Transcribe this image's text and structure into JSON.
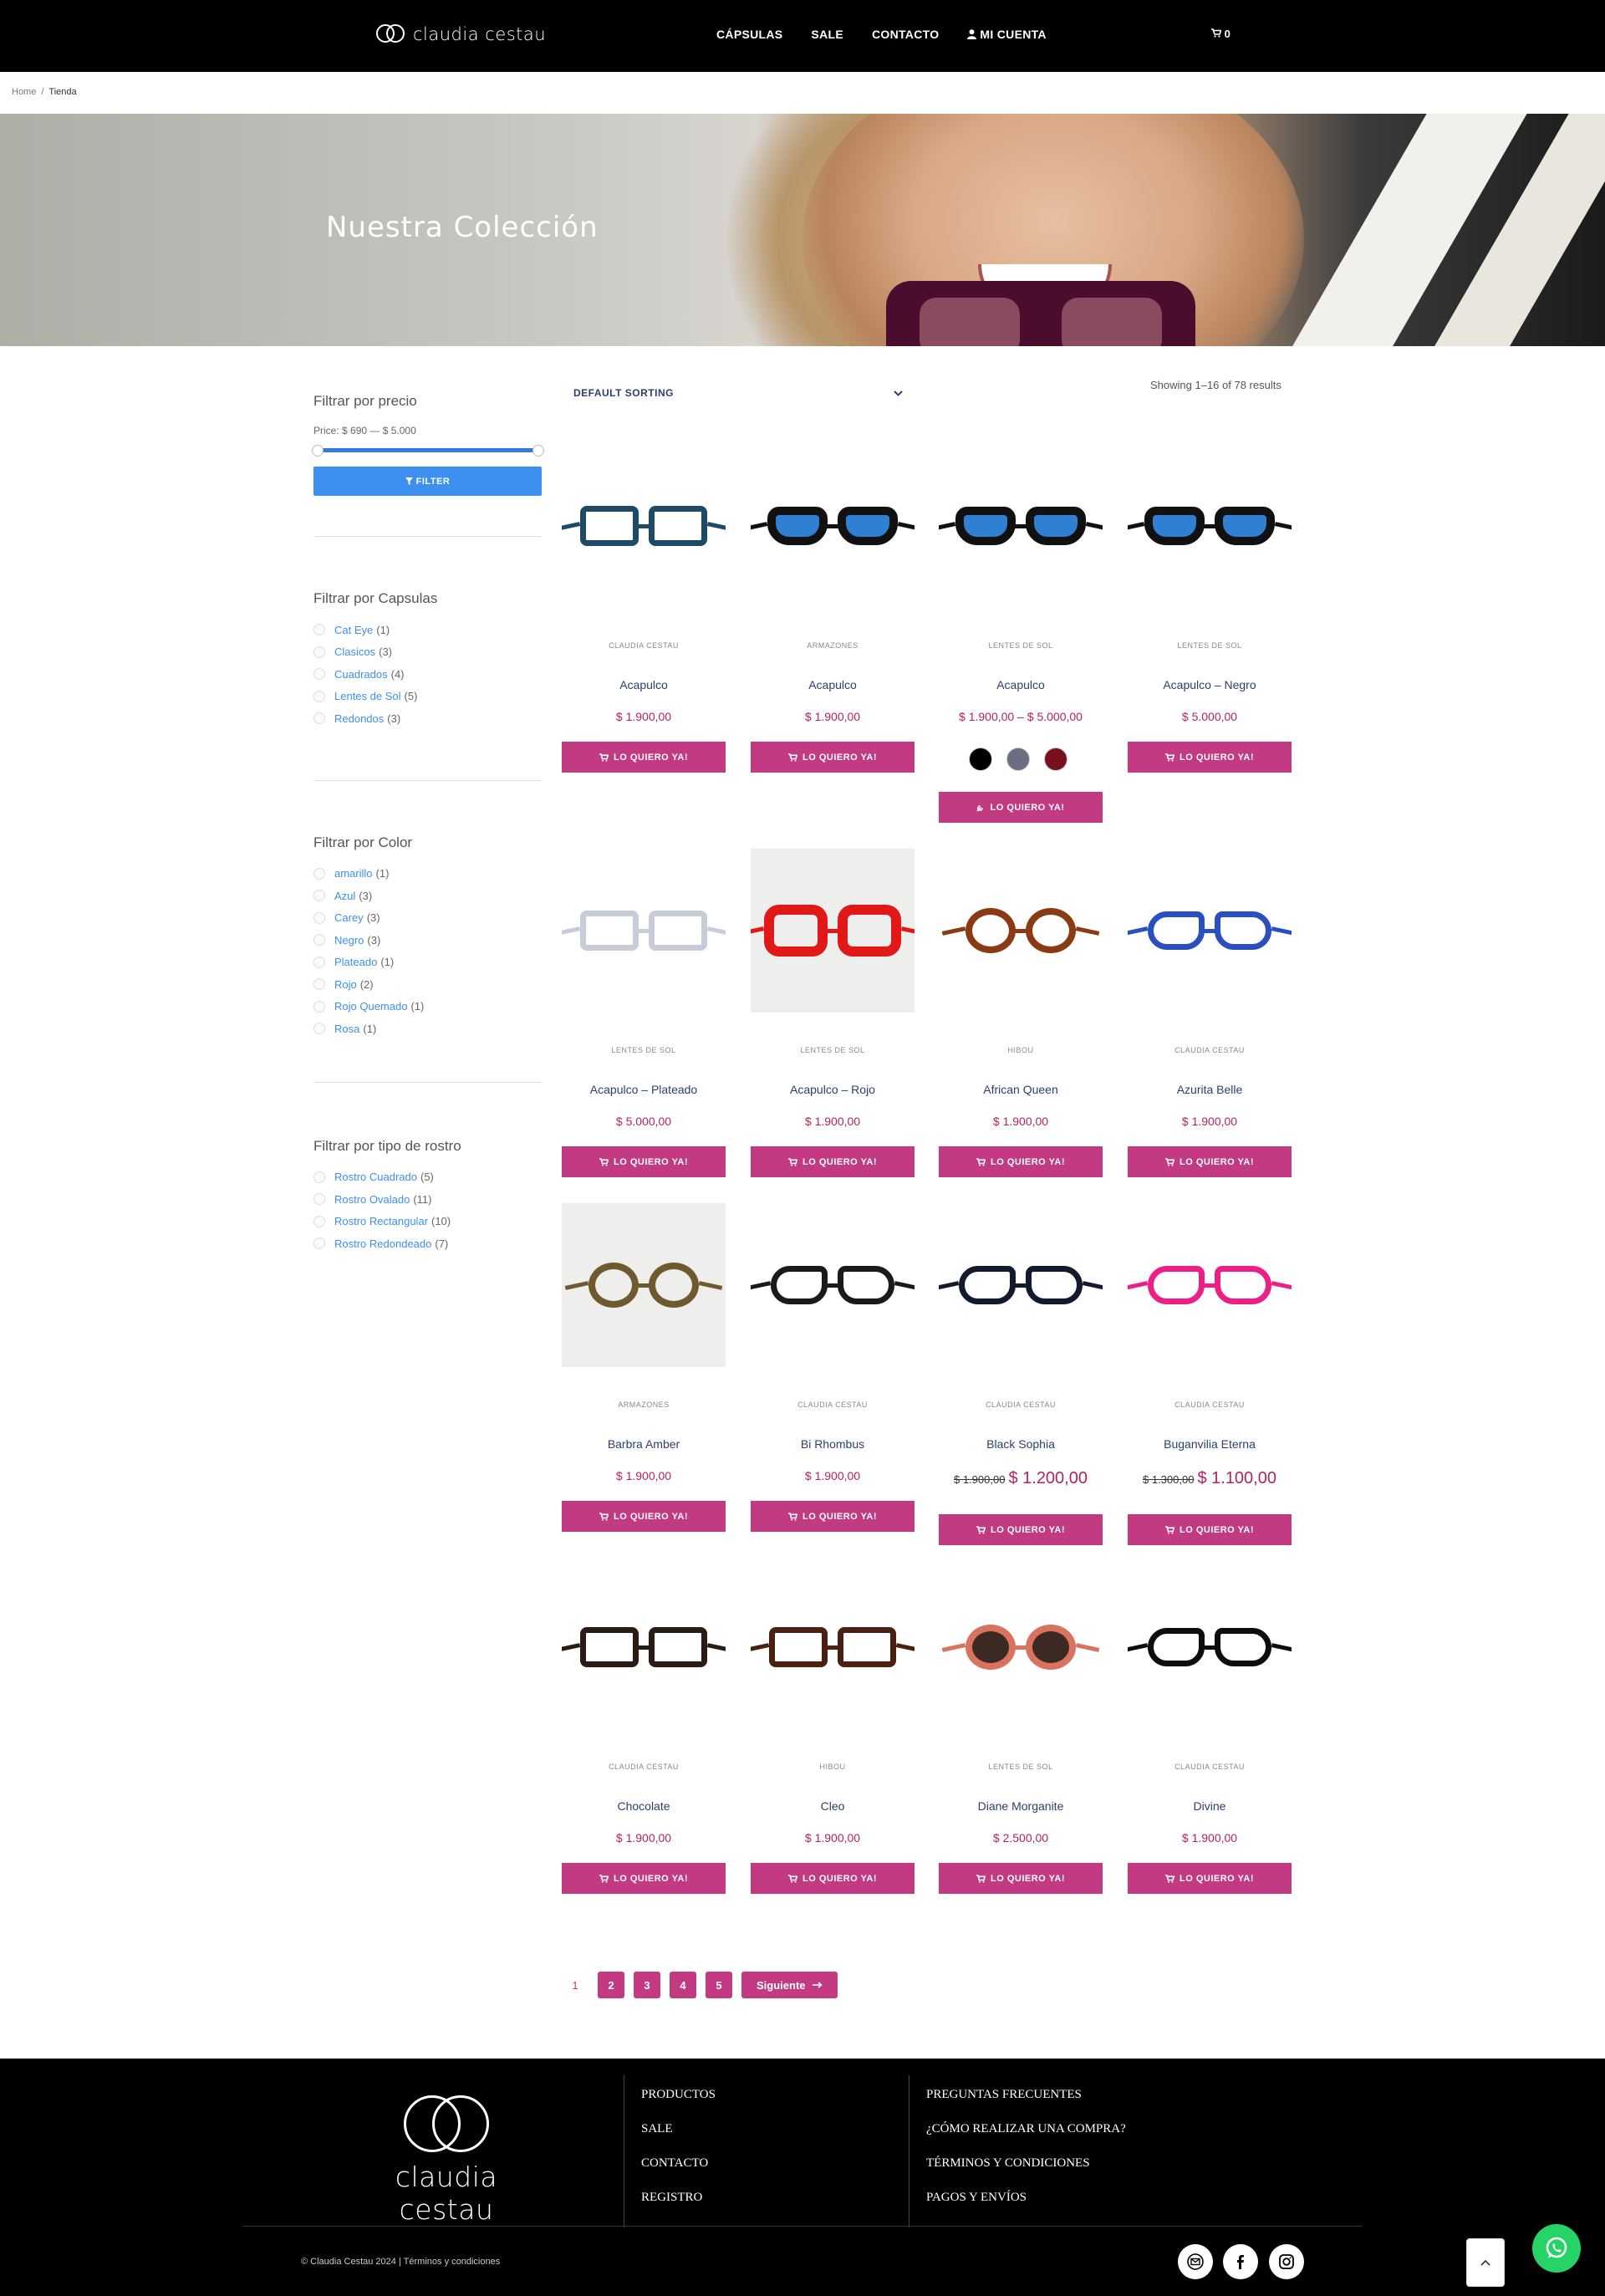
{
  "header": {
    "logo_text": "claudia cestau",
    "nav": [
      "CÁPSULAS",
      "SALE",
      "CONTACTO",
      "MI CUENTA"
    ],
    "cart_count": "0"
  },
  "breadcrumb": {
    "home": "Home",
    "sep": "/",
    "current": "Tienda"
  },
  "hero": {
    "title": "Nuestra Colección"
  },
  "sidebar": {
    "price": {
      "title": "Filtrar por precio",
      "label": "Price: $ 690 — $ 5.000",
      "button": "FILTER"
    },
    "capsulas": {
      "title": "Filtrar por Capsulas",
      "items": [
        {
          "label": "Cat Eye",
          "count": "(1)"
        },
        {
          "label": "Clasicos",
          "count": "(3)"
        },
        {
          "label": "Cuadrados",
          "count": "(4)"
        },
        {
          "label": "Lentes de Sol",
          "count": "(5)"
        },
        {
          "label": "Redondos",
          "count": "(3)"
        }
      ]
    },
    "color": {
      "title": "Filtrar por Color",
      "items": [
        {
          "label": "amarillo",
          "count": "(1)"
        },
        {
          "label": "Azul",
          "count": "(3)"
        },
        {
          "label": "Carey",
          "count": "(3)"
        },
        {
          "label": "Negro",
          "count": "(3)"
        },
        {
          "label": "Plateado",
          "count": "(1)"
        },
        {
          "label": "Rojo",
          "count": "(2)"
        },
        {
          "label": "Rojo Quemado",
          "count": "(1)"
        },
        {
          "label": "Rosa",
          "count": "(1)"
        }
      ]
    },
    "rostro": {
      "title": "Filtrar por tipo de rostro",
      "items": [
        {
          "label": "Rostro Cuadrado",
          "count": "(5)"
        },
        {
          "label": "Rostro Ovalado",
          "count": "(11)"
        },
        {
          "label": "Rostro Rectangular",
          "count": "(10)"
        },
        {
          "label": "Rostro Redondeado",
          "count": "(7)"
        }
      ]
    }
  },
  "shop": {
    "sorting": "DEFAULT SORTING",
    "result_count": "Showing 1–16 of 78 results",
    "buy_label": "LO QUIERO YA!"
  },
  "products": [
    {
      "category": "CLAUDIA CESTAU",
      "name": "Acapulco",
      "price": "$ 1.900,00",
      "frame": "#1f4a66",
      "lens": "transparent",
      "shape": "square",
      "bg": "white"
    },
    {
      "category": "ARMAZONES",
      "name": "Acapulco",
      "price": "$ 1.900,00",
      "frame": "#111111",
      "lens": "#2f7fd3",
      "shape": "wayfarer",
      "bg": "white"
    },
    {
      "category": "LENTES DE SOL",
      "name": "Acapulco",
      "price": "$ 1.900,00 – $ 5.000,00",
      "frame": "#111111",
      "lens": "#2f7fd3",
      "shape": "wayfarer",
      "bg": "white",
      "swatches": [
        "#000000",
        "#6b6e80",
        "#7a0f1f"
      ]
    },
    {
      "category": "LENTES DE SOL",
      "name": "Acapulco – Negro",
      "price": "$ 5.000,00",
      "frame": "#111111",
      "lens": "#2f7fd3",
      "shape": "wayfarer",
      "bg": "white"
    },
    {
      "category": "LENTES DE SOL",
      "name": "Acapulco – Plateado",
      "price": "$ 5.000,00",
      "frame": "#c7ccd8",
      "lens": "transparent",
      "shape": "square",
      "bg": "white"
    },
    {
      "category": "LENTES DE SOL",
      "name": "Acapulco – Rojo",
      "price": "$ 1.900,00",
      "frame": "#e01818",
      "lens": "transparent",
      "shape": "hexagon",
      "bg": "gray"
    },
    {
      "category": "HIBOU",
      "name": "African Queen",
      "price": "$ 1.900,00",
      "frame": "#8a3b14",
      "lens": "transparent",
      "shape": "round",
      "bg": "white"
    },
    {
      "category": "CLAUDIA CESTAU",
      "name": "Azurita Belle",
      "price": "$ 1.900,00",
      "frame": "#2a4fc0",
      "lens": "transparent",
      "shape": "cateye",
      "bg": "white"
    },
    {
      "category": "ARMAZONES",
      "name": "Barbra Amber",
      "price": "$ 1.900,00",
      "frame": "#6e5a2e",
      "lens": "transparent",
      "shape": "round",
      "bg": "gray"
    },
    {
      "category": "CLAUDIA CESTAU",
      "name": "Bi Rhombus",
      "price": "$ 1.900,00",
      "frame": "#1a1a1a",
      "lens": "transparent",
      "shape": "cateye",
      "bg": "white"
    },
    {
      "category": "CLAUDIA CESTAU",
      "name": "Black Sophia",
      "old_price": "$ 1.900,00",
      "price": "$ 1.200,00",
      "frame": "#141a2e",
      "lens": "transparent",
      "shape": "cateye",
      "bg": "white"
    },
    {
      "category": "CLAUDIA CESTAU",
      "name": "Buganvilia Eterna",
      "old_price": "$ 1.300,00",
      "price": "$ 1.100,00",
      "frame": "#ec1f86",
      "lens": "transparent",
      "shape": "cateye",
      "bg": "white"
    },
    {
      "category": "CLAUDIA CESTAU",
      "name": "Chocolate",
      "price": "$ 1.900,00",
      "frame": "#2a1b14",
      "lens": "transparent",
      "shape": "square",
      "bg": "white"
    },
    {
      "category": "HIBOU",
      "name": "Cleo",
      "price": "$ 1.900,00",
      "frame": "#4a2010",
      "lens": "transparent",
      "shape": "square",
      "bg": "white"
    },
    {
      "category": "LENTES DE SOL",
      "name": "Diane Morganite",
      "price": "$ 2.500,00",
      "frame": "#d9735f",
      "lens": "#3a2a22",
      "shape": "round",
      "bg": "white"
    },
    {
      "category": "CLAUDIA CESTAU",
      "name": "Divine",
      "price": "$ 1.900,00",
      "frame": "#0d0d0d",
      "lens": "transparent",
      "shape": "cateye",
      "bg": "white"
    }
  ],
  "pagination": [
    "1",
    "2",
    "3",
    "4",
    "5"
  ],
  "pagination_next": "Siguiente",
  "footer": {
    "logo_text": "claudia cestau",
    "col1": [
      "PRODUCTOS",
      "SALE",
      "CONTACTO",
      "REGISTRO"
    ],
    "col2": [
      "PREGUNTAS FRECUENTES",
      "¿CÓMO REALIZAR UNA COMPRA?",
      "TÉRMINOS Y CONDICIONES",
      "PAGOS Y ENVÍOS"
    ],
    "copyright": "© Claudia Cestau 2024 | Términos y condiciones"
  },
  "colors": {
    "accent": "#c13a82",
    "link": "#3d8ff0",
    "price": "#b1245c"
  }
}
